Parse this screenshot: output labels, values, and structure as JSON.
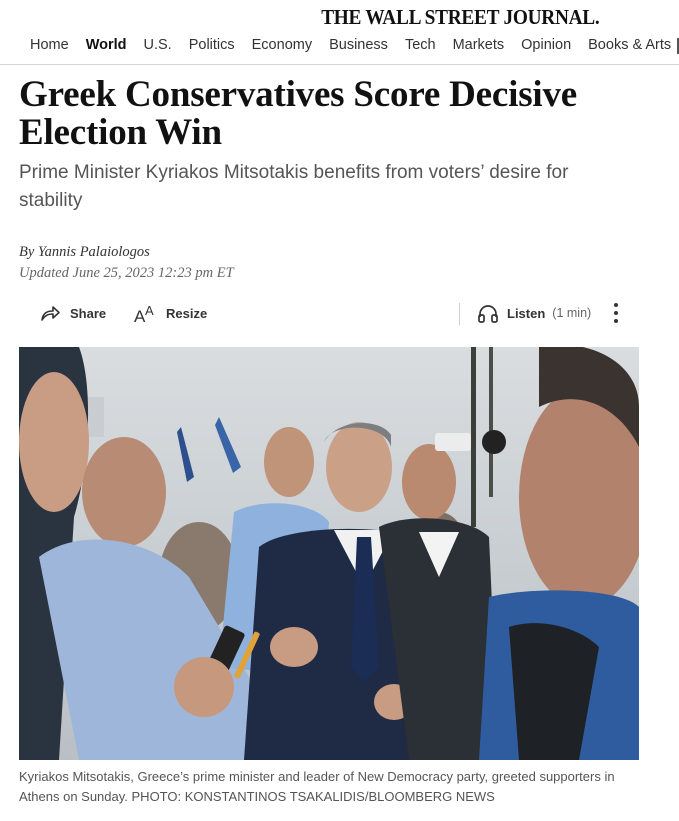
{
  "masthead": {
    "logo_text": "THE WALL STREET JOURNAL."
  },
  "nav": {
    "items": [
      "Home",
      "World",
      "U.S.",
      "Politics",
      "Economy",
      "Business",
      "Tech",
      "Markets",
      "Opinion",
      "Books & Arts"
    ],
    "active": "World"
  },
  "article": {
    "headline": "Greek Conservatives Score Decisive Election Win",
    "dek": "Prime Minister Kyriakos Mitsotakis benefits from voters’ desire for stability",
    "byline_prefix": "By",
    "author": "Yannis Palaiologos",
    "updated": "Updated June 25, 2023 12:23 pm ET"
  },
  "toolbar": {
    "share_label": "Share",
    "resize_label": "Resize",
    "listen_label": "Listen",
    "listen_duration": "(1 min)"
  },
  "photo": {
    "caption": "Kyriakos Mitsotakis, Greece’s prime minister and leader of New Democracy party, greeted supporters in Athens on Sunday. PHOTO: KONSTANTINOS TSAKALIDIS/BLOOMBERG NEWS"
  },
  "colors": {
    "text": "#111111",
    "muted": "#555555",
    "divider": "#d6d6d6"
  },
  "icons": [
    "share-icon",
    "resize-icon",
    "headphones-icon",
    "more-vertical-icon"
  ]
}
